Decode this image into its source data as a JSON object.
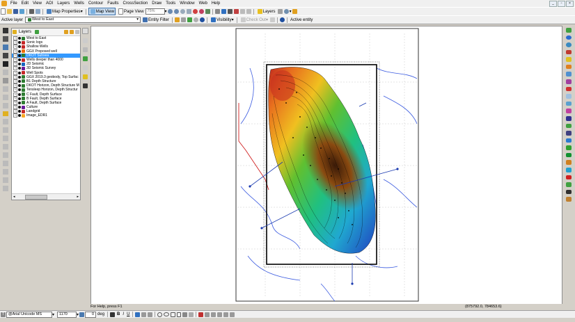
{
  "menu": {
    "items": [
      "File",
      "Edit",
      "View",
      "AOI",
      "Layers",
      "Wells",
      "Contour",
      "Faults",
      "CrossSection",
      "Draw",
      "Tools",
      "Window",
      "Web",
      "Help"
    ]
  },
  "toolbar": {
    "map_properties": "Map Properties",
    "map_view": "Map View",
    "page_view": "Page View",
    "zoom": "75%",
    "layers": "Layers"
  },
  "toolbar2": {
    "active_layer_label": "Active layer",
    "active_layer_value": "West to East",
    "entity_filter": "Entity Filter",
    "visibility": "Visibility",
    "check_out": "Check Out",
    "active_entity": "Active entity"
  },
  "layers_panel": {
    "title": "Layers",
    "items": [
      {
        "label": "West to East",
        "selected": false,
        "color": "#2e7d32"
      },
      {
        "label": "Sonic logs",
        "selected": false,
        "color": "#c62828"
      },
      {
        "label": "Shallow Wells",
        "selected": false,
        "color": "#c62828"
      },
      {
        "label": "GGX Proposed well",
        "selected": false,
        "color": "#ef6c00"
      },
      {
        "label": "DKOT Subsea",
        "selected": true,
        "color": "#2e7d32"
      },
      {
        "label": "Wells deeper than 4000",
        "selected": false,
        "color": "#c62828"
      },
      {
        "label": "2D Seismic",
        "selected": false,
        "color": "#1565c0"
      },
      {
        "label": "3D Seismic Survey",
        "selected": false,
        "color": "#6a1b9a"
      },
      {
        "label": "Well Spots",
        "selected": false,
        "color": "#c62828"
      },
      {
        "label": "GGX 2019.3 geobody, Top Surfac",
        "selected": false,
        "color": "#2e7d32"
      },
      {
        "label": "B1 Depth Structure",
        "selected": false,
        "color": "#2e7d32"
      },
      {
        "label": "DKOT Horizon, Depth Structure M",
        "selected": false,
        "color": "#2e7d32"
      },
      {
        "label": "Tensleep Horizon, Depth Structur",
        "selected": false,
        "color": "#2e7d32"
      },
      {
        "label": "C Fault, Depth Surface",
        "selected": false,
        "color": "#2e7d32"
      },
      {
        "label": "B Fault, Depth Surface",
        "selected": false,
        "color": "#2e7d32"
      },
      {
        "label": "A Fault, Depth Surface",
        "selected": false,
        "color": "#2e7d32"
      },
      {
        "label": "Culture",
        "selected": false,
        "color": "#6a1b9a"
      },
      {
        "label": "Landgrid",
        "selected": false,
        "color": "#c62828"
      },
      {
        "label": "Image_EDR1",
        "selected": false,
        "color": "#f9a825"
      }
    ]
  },
  "status": {
    "help": "For Help, press F1",
    "coords": "(875792.0, 784653.6)"
  },
  "format_bar": {
    "font": "@Arial Unicode MS",
    "size": "1170",
    "angle": "0",
    "angle_unit": "deg"
  }
}
